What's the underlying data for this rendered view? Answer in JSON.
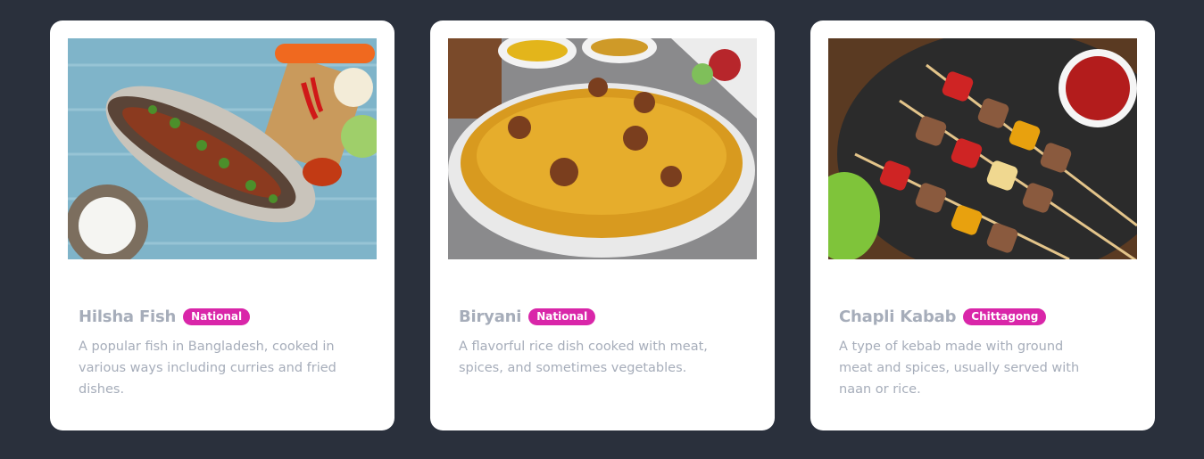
{
  "cards": [
    {
      "image": "hilsha-fish-photo",
      "title": "Hilsha Fish",
      "badge": "National",
      "description": "A popular fish in Bangladesh, cooked in various ways including curries and fried dishes."
    },
    {
      "image": "biryani-photo",
      "title": "Biryani",
      "badge": "National",
      "description": "A flavorful rice dish cooked with meat, spices, and sometimes vegetables."
    },
    {
      "image": "chapli-kabab-photo",
      "title": "Chapli Kabab",
      "badge": "Chittagong",
      "description": "A type of kebab made with ground meat and spices, usually served with naan or rice."
    }
  ],
  "colors": {
    "page_bg": "#2a303c",
    "card_bg": "#ffffff",
    "badge_bg": "#d926a9",
    "text_muted": "#a6adba"
  }
}
